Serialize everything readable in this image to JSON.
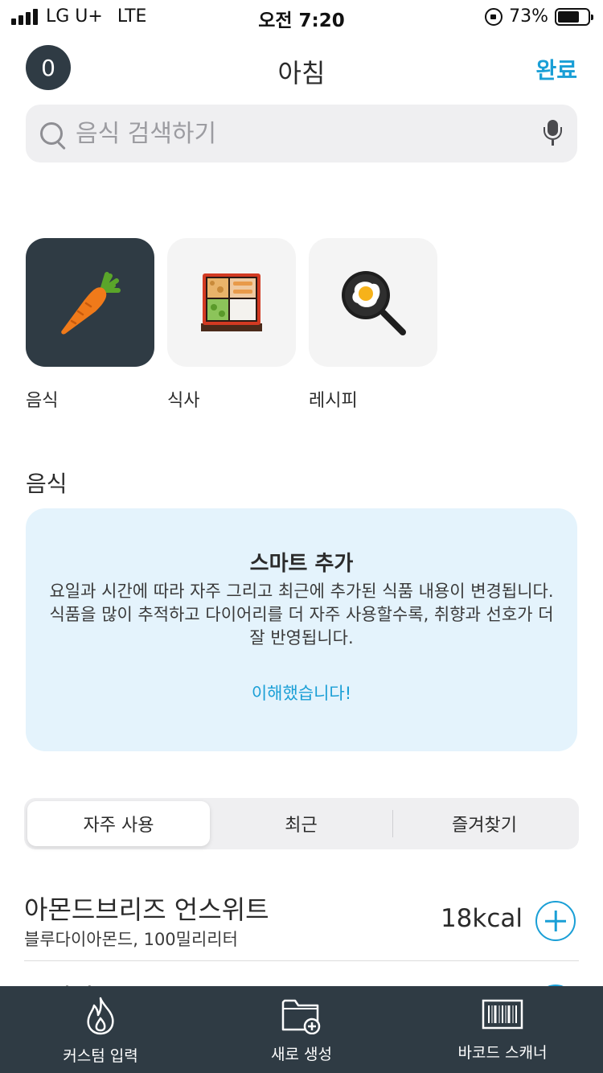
{
  "status_bar": {
    "carrier": "LG U+",
    "network": "LTE",
    "time": "오전 7:20",
    "battery_text": "73%",
    "battery_level": 0.73
  },
  "header": {
    "counter": "0",
    "title": "아침",
    "done_label": "완료"
  },
  "search": {
    "placeholder": "음식 검색하기"
  },
  "categories": [
    {
      "label": "음식",
      "icon": "carrot-icon",
      "active": true
    },
    {
      "label": "식사",
      "icon": "bento-box-icon",
      "active": false
    },
    {
      "label": "레시피",
      "icon": "frying-pan-egg-icon",
      "active": false
    }
  ],
  "section": {
    "title": "음식"
  },
  "smart_add": {
    "title": "스마트 추가",
    "body": "요일과 시간에 따라 자주 그리고 최근에 추가된 식품 내용이 변경됩니다. 식품을 많이 추적하고 다이어리를 더 자주 사용할수록, 취향과 선호가 더 잘 반영됩니다.",
    "ack_label": "이해했습니다!"
  },
  "tabs": [
    {
      "label": "자주 사용",
      "selected": true
    },
    {
      "label": "최근",
      "selected": false
    },
    {
      "label": "즐겨찾기",
      "selected": false
    }
  ],
  "food_items": [
    {
      "name": "아몬드브리즈 언스위트",
      "detail": "블루다이아몬드, 100밀리리터",
      "kcal": "18kcal"
    },
    {
      "name": "우리나",
      "detail": "",
      "kcal": ""
    }
  ],
  "bottom_bar": [
    {
      "label": "커스텀 입력",
      "icon": "flame-icon"
    },
    {
      "label": "새로 생성",
      "icon": "folder-add-icon"
    },
    {
      "label": "바코드 스캐너",
      "icon": "barcode-icon"
    }
  ],
  "colors": {
    "accent": "#1a9fd6",
    "dark": "#2f3b44",
    "info_bg": "#e4f3fc",
    "search_bg": "#efeff1"
  }
}
